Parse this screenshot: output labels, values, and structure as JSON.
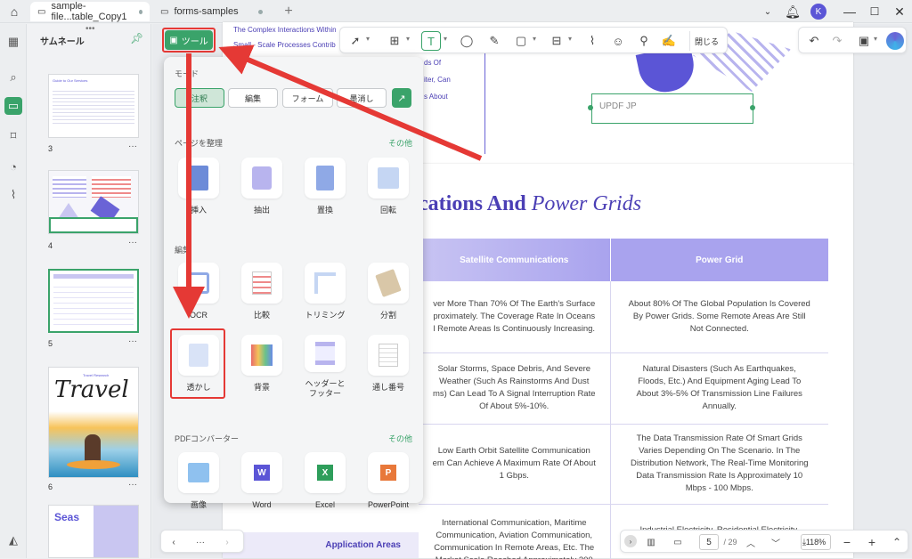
{
  "tabs": [
    {
      "label": "sample-file...table_Copy1"
    },
    {
      "label": "forms-samples"
    }
  ],
  "thumbnails": {
    "title": "サムネール",
    "pages": [
      "3",
      "4",
      "5",
      "6"
    ],
    "page3_heading": "Guide to Our Services",
    "page6_title": "Travel",
    "page6_subtitle": "Travel Research",
    "page7_text": "Seas"
  },
  "document": {
    "top_links": [
      "The Complex Interactions Within",
      "Small - Scale Processes Contrib",
      "ds Of",
      "iter, Can",
      "s About"
    ],
    "form_field_text": "UPDF JP",
    "heading_plain": "cations And",
    "heading_italic": "Power Grids",
    "table": {
      "headers": [
        "Satellite Communications",
        "Power Grid"
      ],
      "rows": [
        [
          "ver More Than 70% Of The Earth's Surface\nproximately. The Coverage Rate In Oceans\nl Remote Areas Is Continuously Increasing.",
          "About 80% Of The Global Population Is Covered\nBy Power Grids. Some Remote Areas Are Still\nNot Connected."
        ],
        [
          "Solar Storms, Space Debris, And Severe\nWeather (Such As Rainstorms And Dust\nms) Can Lead To A Signal Interruption Rate\nOf About 5%-10%.",
          "Natural Disasters (Such As Earthquakes,\nFloods, Etc.) And Equipment Aging Lead To\nAbout 3%-5% Of Transmission Line Failures\nAnnually."
        ],
        [
          "Low Earth Orbit Satellite Communication\nem Can Achieve A Maximum Rate Of About\n1 Gbps.",
          "The Data Transmission Rate Of Smart Grids\nVaries Depending On The Scenario. In The\nDistribution Network, The Real-Time Monitoring\nData Transmission Rate Is Approximately 10\nMbps - 100 Mbps."
        ],
        [
          "International Communication, Maritime\nCommunication, Aviation Communication,\nCommunication In Remote Areas, Etc. The\nMarket Scale Reached Approximately 300",
          "Industrial Electricity, Residential Electricity,"
        ]
      ]
    },
    "application_areas": "Application Areas"
  },
  "toolbar": {
    "close_label": "閉じる"
  },
  "tools_button": {
    "label": "ツール"
  },
  "popup": {
    "mode_title": "モード",
    "modes": [
      "注釈",
      "編集",
      "フォーム",
      "墨消し"
    ],
    "organize_title": "ページを整理",
    "organize_more": "その他",
    "organize_tools": [
      "挿入",
      "抽出",
      "置換",
      "回転"
    ],
    "edit_title": "編集",
    "edit_tools_row1": [
      "OCR",
      "比較",
      "トリミング",
      "分割"
    ],
    "edit_tools_row2": [
      "透かし",
      "背景",
      "ヘッダーと\nフッター",
      "通し番号"
    ],
    "converter_title": "PDFコンバーター",
    "converter_more": "その他",
    "converters": [
      "画像",
      "Word",
      "Excel",
      "PowerPoint"
    ]
  },
  "pager": {
    "current": "5",
    "total": "/ 29",
    "zoom": "118%"
  },
  "user_initial": "K",
  "colors": {
    "accent": "#3aa36a",
    "annotation_arrow": "#e53935",
    "table_header": "#a9a3ee",
    "heading": "#4b3fb5"
  }
}
